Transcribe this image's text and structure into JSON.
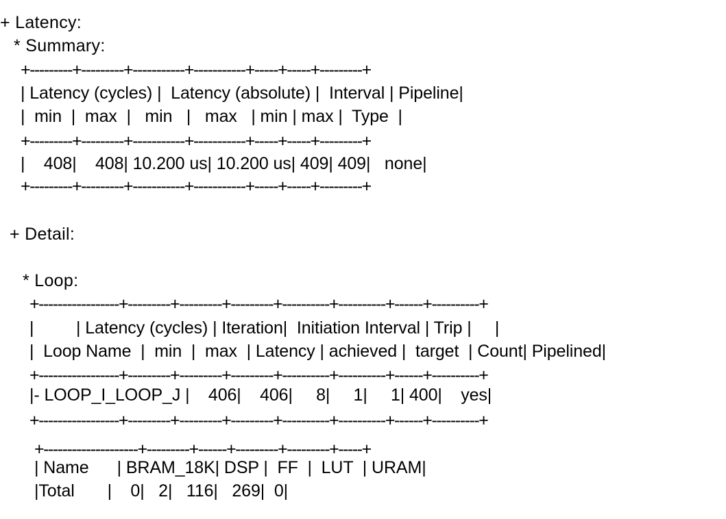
{
  "document": {
    "kind": "hls-synthesis-report",
    "background_color": "#ffffff",
    "text_color": "#000000"
  },
  "latency": {
    "heading": "+ Latency:",
    "summary": {
      "heading": "* Summary:",
      "rule": "+---------+---------+-----------+-----------+-----+-----+---------+",
      "header_row_1": "| Latency (cycles) |  Latency (absolute) |  Interval | Pipeline|",
      "header_row_2": "|  min  |  max  |   min   |   max   | min | max |  Type  |",
      "columns_group": [
        "Latency (cycles)",
        "Latency (absolute)",
        "Interval",
        "Pipeline"
      ],
      "columns": [
        "min",
        "max",
        "min",
        "max",
        "min",
        "max",
        "Type"
      ],
      "data_row": "|    408|    408| 10.200 us| 10.200 us| 409| 409|   none|",
      "values": {
        "latency_cycles_min": "408",
        "latency_cycles_max": "408",
        "latency_absolute_min": "10.200 us",
        "latency_absolute_max": "10.200 us",
        "interval_min": "409",
        "interval_max": "409",
        "pipeline_type": "none"
      }
    }
  },
  "detail": {
    "heading": "+ Detail:",
    "loop": {
      "heading": "* Loop:",
      "rule": "+-----------------+---------+---------+---------+----------+----------+------+----------+",
      "header_row_1": "|         | Latency (cycles) | Iteration|  Initiation Interval | Trip |     |",
      "header_row_2": "|  Loop Name  |  min  |  max  | Latency | achieved |  target  | Count| Pipelined|",
      "columns_group": [
        "Latency (cycles)",
        "Iteration",
        "Initiation Interval",
        "Trip"
      ],
      "columns": [
        "Loop Name",
        "min",
        "max",
        "Latency",
        "achieved",
        "target",
        "Count",
        "Pipelined"
      ],
      "data_row": "|- LOOP_I_LOOP_J |    406|    406|     8|     1|     1| 400|    yes|",
      "values": {
        "loop_name": "- LOOP_I_LOOP_J",
        "latency_min": "406",
        "latency_max": "406",
        "iteration_latency": "8",
        "initiation_interval_achieved": "1",
        "initiation_interval_target": "1",
        "trip_count": "400",
        "pipelined": "yes"
      }
    }
  },
  "utilization": {
    "rule": "+--------------------+---------+------+---------+---------+-----+",
    "header_row": "| Name      | BRAM_18K| DSP |  FF  |  LUT  | URAM|",
    "columns": [
      "Name",
      "BRAM_18K",
      "DSP",
      "FF",
      "LUT",
      "URAM"
    ],
    "total_row": "|Total       |    0|   2|   116|   269|  0|",
    "values": {
      "name": "Total",
      "bram_18k": "0",
      "dsp": "2",
      "ff": "116",
      "lut": "269",
      "uram": "0"
    }
  }
}
